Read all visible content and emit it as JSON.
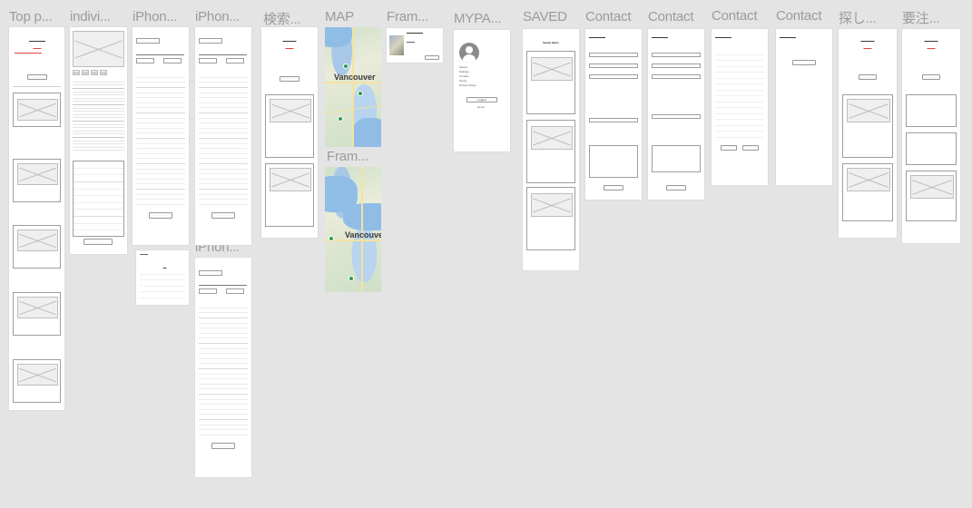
{
  "canvas": {
    "top_note": [
      "· ·",
      "· · · ·",
      "· · · · ·"
    ]
  },
  "frames": [
    {
      "id": "top",
      "label": "Top p..."
    },
    {
      "id": "indiv",
      "label": "indivi..."
    },
    {
      "id": "iphone1",
      "label": "iPhon..."
    },
    {
      "id": "iphone2",
      "label": "iPhon..."
    },
    {
      "id": "search",
      "label": "検索..."
    },
    {
      "id": "map",
      "label": "MAP"
    },
    {
      "id": "frame1",
      "label": "Fram..."
    },
    {
      "id": "mypage",
      "label": "MYPA..."
    },
    {
      "id": "saved",
      "label": "SAVED"
    },
    {
      "id": "contact1",
      "label": "Contact"
    },
    {
      "id": "contact2",
      "label": "Contact"
    },
    {
      "id": "contact3",
      "label": "Contact"
    },
    {
      "id": "contact4",
      "label": "Contact"
    },
    {
      "id": "sagashi",
      "label": "探し..."
    },
    {
      "id": "yochu",
      "label": "要注..."
    },
    {
      "id": "frame2",
      "label": "Fram..."
    },
    {
      "id": "iphone3",
      "label": "iPhon..."
    }
  ],
  "map": {
    "label_city": "Vancouver",
    "label_city2": "Vancouver"
  },
  "saved": {
    "title": "Saved Items"
  },
  "mypage": {
    "items": [
      "Saved",
      "Settings",
      "Contact",
      "Terms",
      "Privacy Policy"
    ],
    "button": "Logout",
    "link": "Home"
  },
  "colors": {
    "canvas_bg": "#e4e4e4",
    "frame_bg": "#ffffff",
    "label": "#9b9b9b",
    "accent_red": "#e0302b"
  }
}
